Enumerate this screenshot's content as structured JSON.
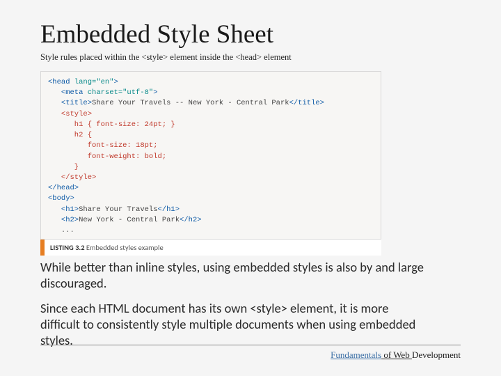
{
  "title": "Embedded Style Sheet",
  "subtitle": "Style rules placed within the <style> element inside the <head> element",
  "code": {
    "l1a": "<head ",
    "l1b": "lang=\"en\"",
    "l1c": ">",
    "l2a": "   <meta ",
    "l2b": "charset=\"utf-8\"",
    "l2c": ">",
    "l3a": "   <title>",
    "l3b": "Share Your Travels -- New York - Central Park",
    "l3c": "</title>",
    "l4": "   <style>",
    "l5": "      h1 { font-size: 24pt; }",
    "l6": "      h2 {",
    "l7": "         font-size: 18pt;",
    "l8": "         font-weight: bold;",
    "l9": "      }",
    "l10": "   </style>",
    "l11": "</head>",
    "l12": "<body>",
    "l13a": "   <h1>",
    "l13b": "Share Your Travels",
    "l13c": "</h1>",
    "l14a": "   <h2>",
    "l14b": "New York - Central Park",
    "l14c": "</h2>",
    "l15": "   ..."
  },
  "listing": {
    "num": "LISTING 3.2",
    "caption": " Embedded styles example"
  },
  "para1": "While better than inline styles, using embedded styles is also by and large discouraged.",
  "para2": "Since each HTML document has its own <style> element, it is more difficult to consistently style multiple documents when using embedded styles.",
  "footer": {
    "w1": "Fundamentals",
    "w2": " of Web ",
    "w3": "Development"
  }
}
